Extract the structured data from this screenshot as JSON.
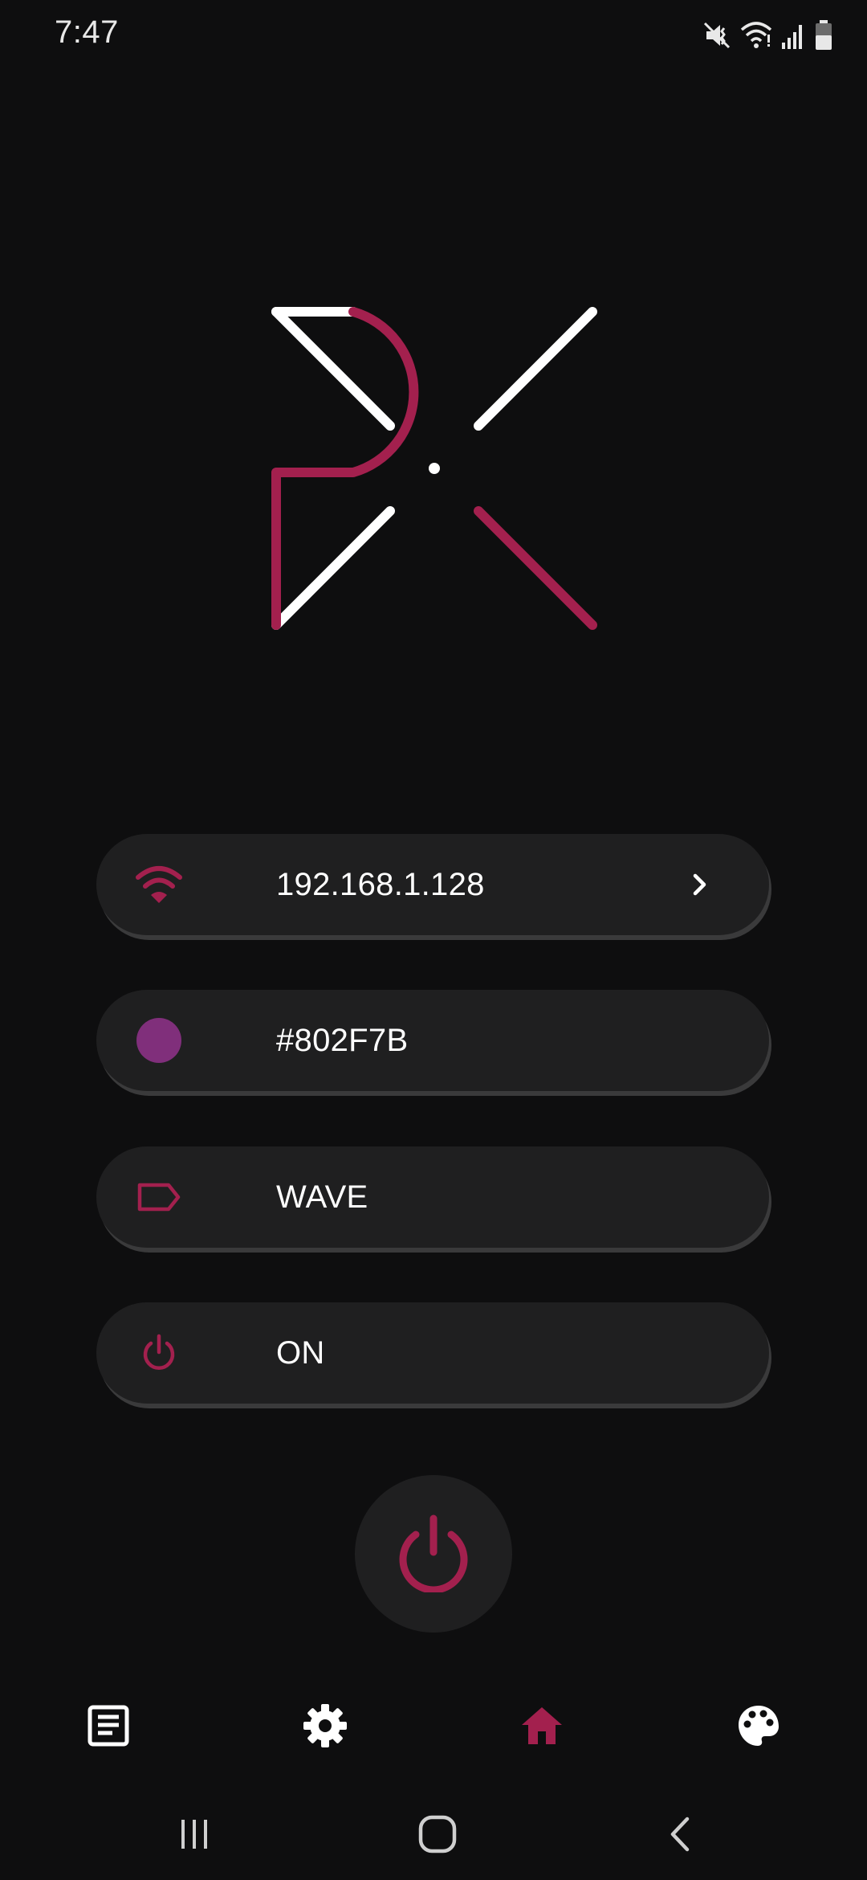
{
  "status_bar": {
    "time": "7:47",
    "icons": [
      "mute-vibrate-icon",
      "wifi-icon",
      "signal-icon",
      "battery-icon"
    ]
  },
  "logo": {
    "name": "px-logo",
    "colors": {
      "primary": "#A3204E",
      "secondary": "#FFFFFF"
    }
  },
  "items": [
    {
      "name": "ip-address",
      "icon": "wifi-icon",
      "label": "192.168.1.128",
      "has_chevron": true
    },
    {
      "name": "color",
      "icon": "color-dot-icon",
      "label": "#802F7B",
      "swatch": "#802F7B"
    },
    {
      "name": "mode",
      "icon": "tag-icon",
      "label": "WAVE"
    },
    {
      "name": "power-state",
      "icon": "power-icon",
      "label": "ON"
    }
  ],
  "power_fab": {
    "icon": "power-icon"
  },
  "bottom_nav": [
    {
      "name": "log",
      "icon": "document-icon",
      "active": false
    },
    {
      "name": "settings",
      "icon": "gear-icon",
      "active": false
    },
    {
      "name": "home",
      "icon": "home-icon",
      "active": true
    },
    {
      "name": "palette",
      "icon": "palette-icon",
      "active": false
    }
  ],
  "system_nav": [
    "recents-icon",
    "home-circle-icon",
    "back-icon"
  ],
  "colors": {
    "accent": "#A3204E",
    "background": "#0E0E0F",
    "surface": "#1F1F20",
    "text": "#FFFFFF"
  }
}
